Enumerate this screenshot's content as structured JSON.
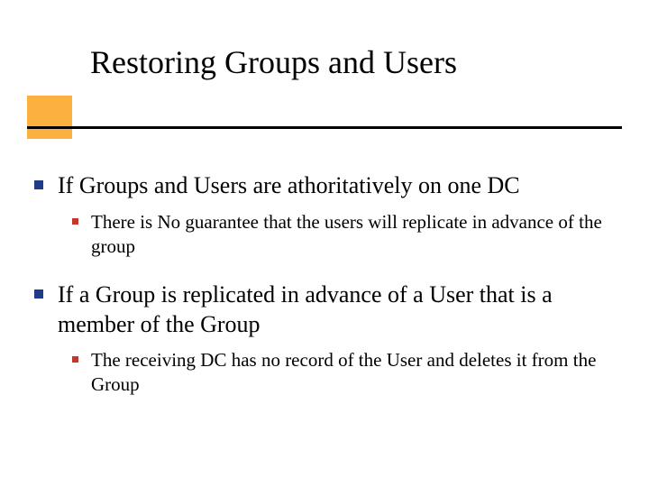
{
  "title": "Restoring Groups and Users",
  "bullets": [
    {
      "text": "If Groups and Users are athoritatively on one DC",
      "children": [
        {
          "text": "There is No guarantee that the users will replicate in advance of the group"
        }
      ]
    },
    {
      "text": "If a Group is replicated in advance of a User that is a member of the Group",
      "children": [
        {
          "text": "The receiving DC has no record of the User and deletes it from the Group"
        }
      ]
    }
  ],
  "colors": {
    "accent_box": "#fbb040",
    "lvl1_bullet": "#1f3b8a",
    "lvl2_bullet": "#c0392b",
    "rule": "#000000"
  }
}
